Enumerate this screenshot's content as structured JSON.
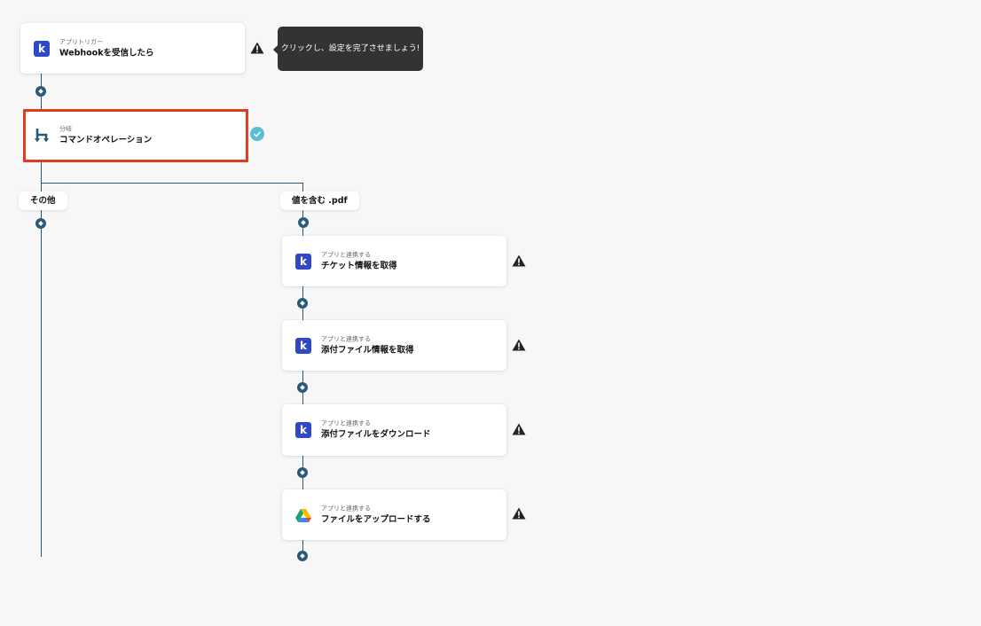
{
  "trigger": {
    "category": "アプリトリガー",
    "title": "Webhookを受信したら",
    "app_icon": "kintone-k-icon"
  },
  "tooltip": {
    "text": "クリックし、設定を完了させましょう!"
  },
  "branch": {
    "category": "分岐",
    "title": "コマンドオペレーション",
    "status_icon": "check-circle-icon",
    "highlight_color": "#e03c1f"
  },
  "paths": {
    "left": {
      "label": "その他"
    },
    "right": {
      "label": "値を含む .pdf"
    }
  },
  "steps": [
    {
      "category": "アプリと連携する",
      "title": "チケット情報を取得",
      "app_icon": "kintone-k-icon",
      "status_icon": "warning-icon"
    },
    {
      "category": "アプリと連携する",
      "title": "添付ファイル情報を取得",
      "app_icon": "kintone-k-icon",
      "status_icon": "warning-icon"
    },
    {
      "category": "アプリと連携する",
      "title": "添付ファイルをダウンロード",
      "app_icon": "kintone-k-icon",
      "status_icon": "warning-icon"
    },
    {
      "category": "アプリと連携する",
      "title": "ファイルをアップロードする",
      "app_icon": "google-drive-icon",
      "status_icon": "warning-icon"
    }
  ],
  "colors": {
    "connector": "#2b5a78",
    "kintone_icon": "#2f48c8",
    "check": "#5bbdd3"
  }
}
